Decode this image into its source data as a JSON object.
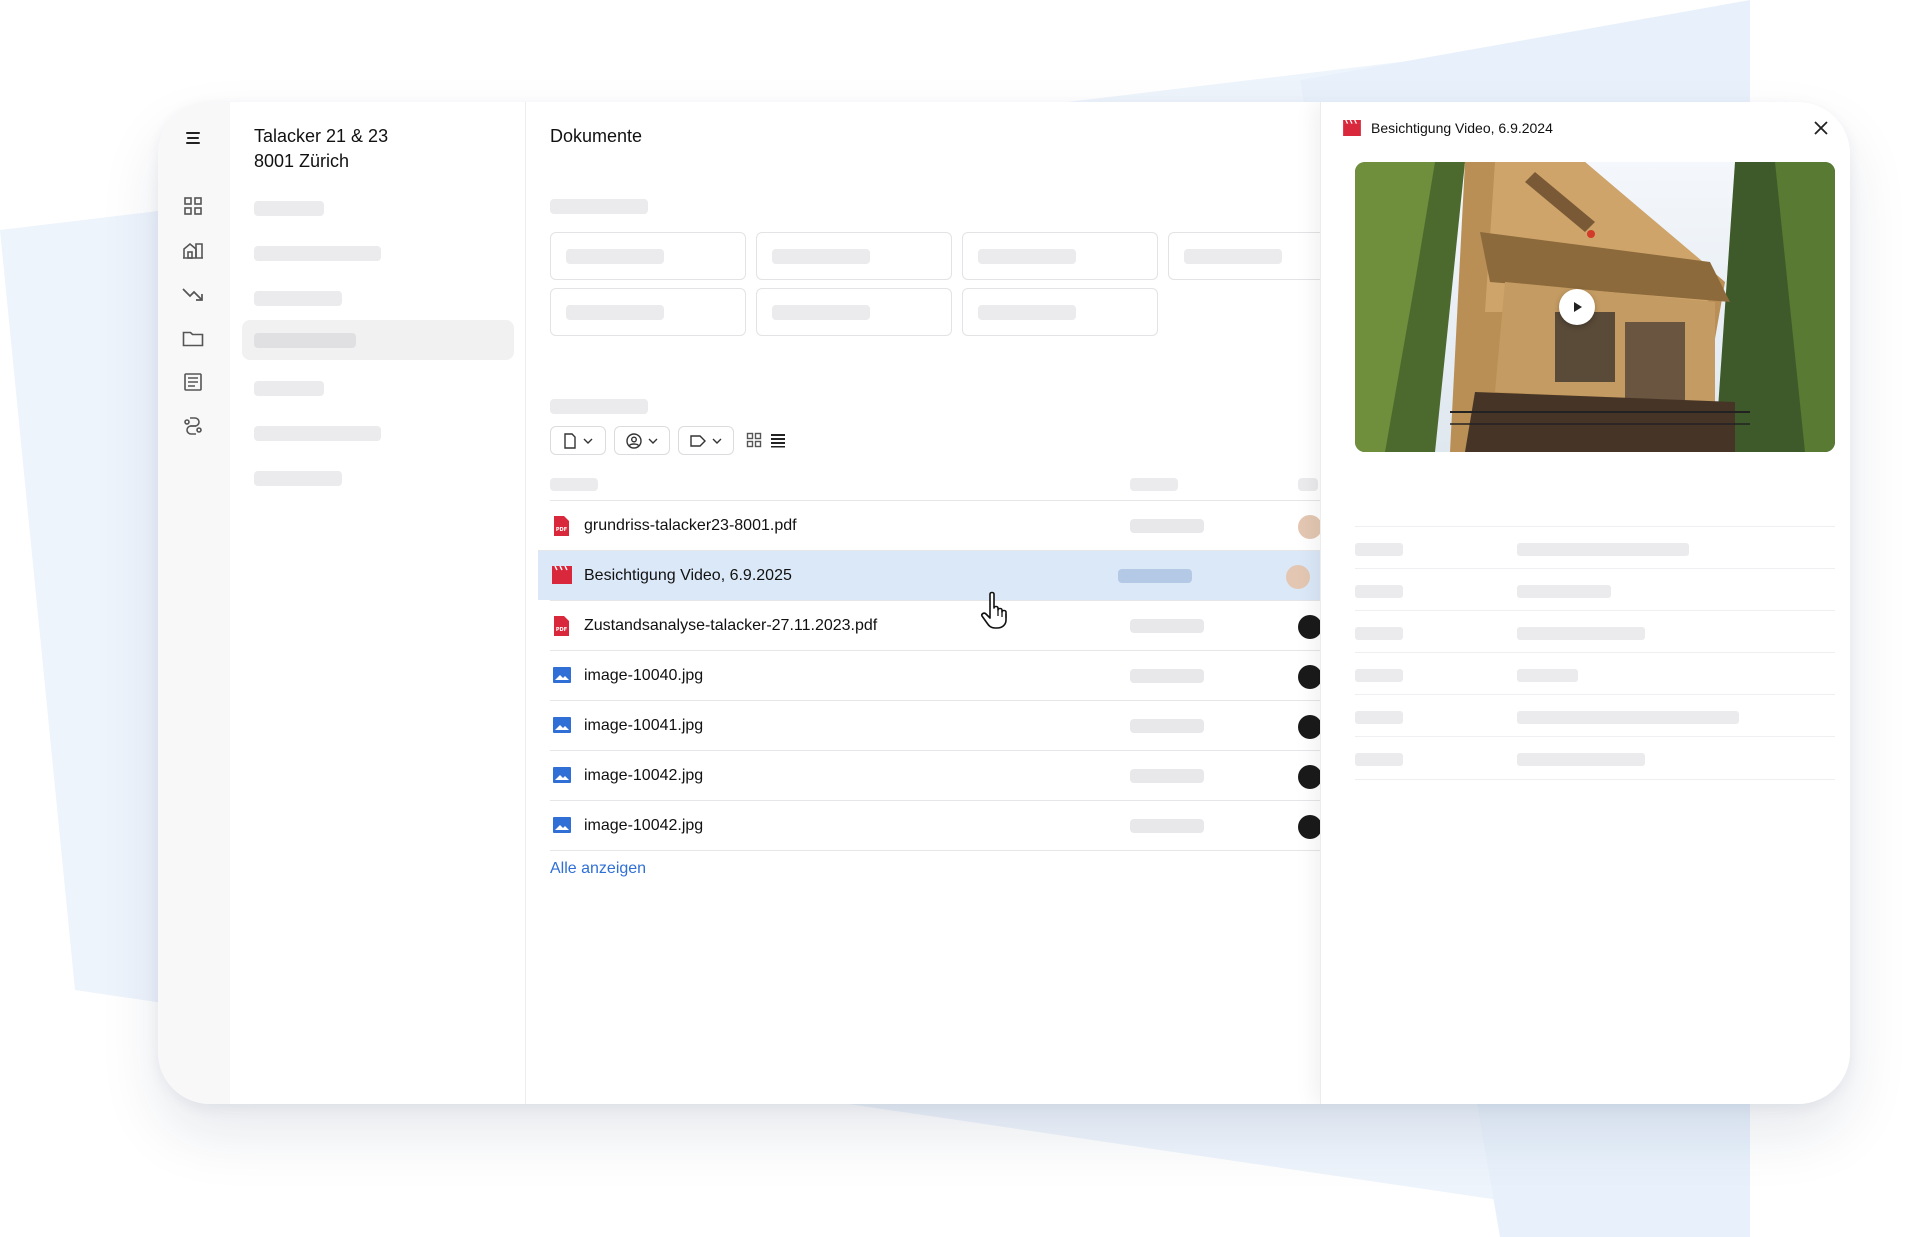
{
  "property": {
    "line1": "Talacker 21 & 23",
    "line2": "8001 Zürich"
  },
  "main": {
    "title": "Dokumente",
    "show_all_label": "Alle anzeigen"
  },
  "documents": [
    {
      "name": "grundriss-talacker23-8001.pdf",
      "type": "pdf",
      "selected": false
    },
    {
      "name": "Besichtigung Video, 6.9.2025",
      "type": "video",
      "selected": true
    },
    {
      "name": "Zustandsanalyse-talacker-27.11.2023.pdf",
      "type": "pdf",
      "selected": false
    },
    {
      "name": "image-10040.jpg",
      "type": "image",
      "selected": false
    },
    {
      "name": "image-10041.jpg",
      "type": "image",
      "selected": false
    },
    {
      "name": "image-10042.jpg",
      "type": "image",
      "selected": false
    },
    {
      "name": "image-10042.jpg",
      "type": "image",
      "selected": false
    }
  ],
  "panel": {
    "title": "Besichtigung Video, 6.9.2024"
  },
  "icons": {
    "rail": [
      "menu-icon",
      "dashboard-grid-icon",
      "building-icon",
      "trend-down-icon",
      "folder-icon",
      "document-list-icon",
      "integration-icon"
    ],
    "pdf": "pdf-file-icon",
    "video": "video-clapper-icon",
    "image": "image-file-icon"
  },
  "colors": {
    "accent_blue": "#2f6fd6",
    "selection_bg": "#dbe8f8",
    "pdf_red": "#d9283b",
    "image_blue": "#2f6fd6"
  }
}
